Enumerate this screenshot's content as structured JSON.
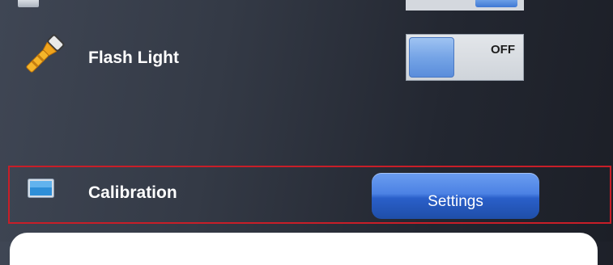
{
  "flash_light": {
    "label": "Flash Light",
    "toggle_state": "OFF",
    "icon": "flashlight-icon"
  },
  "calibration": {
    "label": "Calibration",
    "button_label": "Settings",
    "icon": "monitor-icon"
  },
  "colors": {
    "highlight_border": "#c81e28",
    "button_blue": "#4c82e4",
    "toggle_knob": "#75a4e6"
  }
}
